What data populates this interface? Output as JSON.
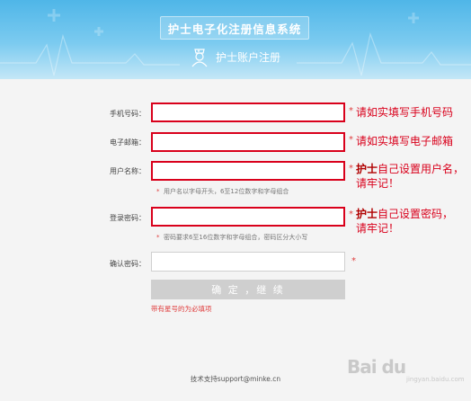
{
  "header": {
    "system_title": "护士电子化注册信息系统",
    "subtitle": "护士账户注册"
  },
  "form": {
    "phone_label": "手机号码：",
    "email_label": "电子邮箱：",
    "username_label": "用户名称：",
    "username_hint": "用户名以字母开头，6至12位数字和字母组合",
    "password_label": "登录密码：",
    "password_hint": "密码要求6至16位数字和字母组合，密码区分大小写",
    "confirm_label": "确认密码：",
    "required_mark": "*",
    "submit_label": "确 定 ，继 续",
    "required_note": "带有星号的为必填项"
  },
  "annotations": {
    "phone_note": "请如实填写手机号码",
    "email_note": "请如实填写电子邮箱",
    "username_note_bold": "护士",
    "username_note_line1": "自己设置用户名，",
    "username_note_line2": "请牢记！",
    "password_note_bold": "护士",
    "password_note_line1": "自己设置密码，",
    "password_note_line2": "请牢记！"
  },
  "footer": {
    "support": "技术支持support@minke.cn"
  },
  "watermark": {
    "text": "Bai du",
    "sub": "jingyan.baidu.com"
  },
  "colors": {
    "header_blue": "#4fb6e8",
    "highlight_red": "#d9001b",
    "button_gray": "#cfcfcf"
  }
}
